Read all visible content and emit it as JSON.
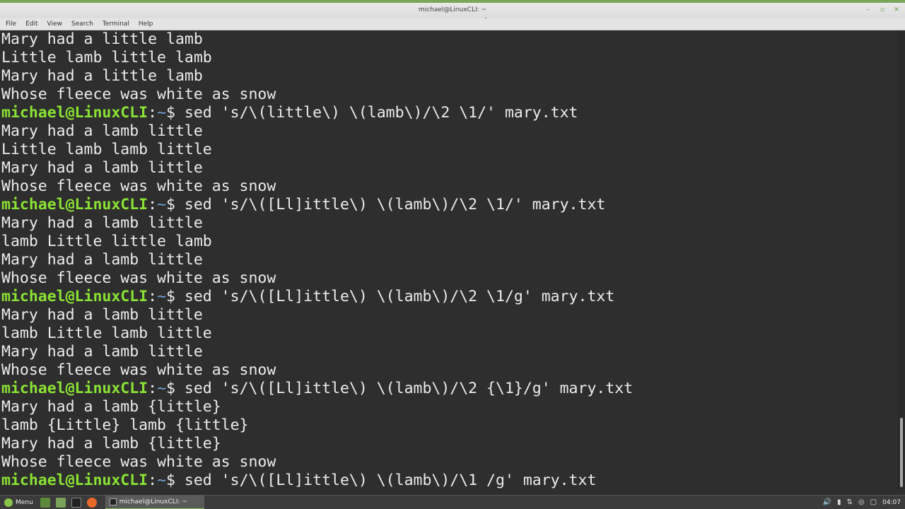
{
  "window": {
    "title": "michael@LinuxCLI: ~",
    "buttons": [
      "–",
      "▫",
      "✕"
    ]
  },
  "menubar": [
    "File",
    "Edit",
    "View",
    "Search",
    "Terminal",
    "Help"
  ],
  "prompt": {
    "user": "michael@LinuxCLI",
    "sep": ":",
    "path": "~",
    "sym": "$ "
  },
  "terminal_lines": [
    {
      "type": "out",
      "text": "Mary had a little lamb"
    },
    {
      "type": "out",
      "text": "Little lamb little lamb"
    },
    {
      "type": "out",
      "text": "Mary had a little lamb"
    },
    {
      "type": "out",
      "text": "Whose fleece was white as snow"
    },
    {
      "type": "cmd",
      "text": "sed 's/\\(little\\) \\(lamb\\)/\\2 \\1/' mary.txt"
    },
    {
      "type": "out",
      "text": "Mary had a lamb little"
    },
    {
      "type": "out",
      "text": "Little lamb lamb little"
    },
    {
      "type": "out",
      "text": "Mary had a lamb little"
    },
    {
      "type": "out",
      "text": "Whose fleece was white as snow"
    },
    {
      "type": "cmd",
      "text": "sed 's/\\([Ll]ittle\\) \\(lamb\\)/\\2 \\1/' mary.txt"
    },
    {
      "type": "out",
      "text": "Mary had a lamb little"
    },
    {
      "type": "out",
      "text": "lamb Little little lamb"
    },
    {
      "type": "out",
      "text": "Mary had a lamb little"
    },
    {
      "type": "out",
      "text": "Whose fleece was white as snow"
    },
    {
      "type": "cmd",
      "text": "sed 's/\\([Ll]ittle\\) \\(lamb\\)/\\2 \\1/g' mary.txt"
    },
    {
      "type": "out",
      "text": "Mary had a lamb little"
    },
    {
      "type": "out",
      "text": "lamb Little lamb little"
    },
    {
      "type": "out",
      "text": "Mary had a lamb little"
    },
    {
      "type": "out",
      "text": "Whose fleece was white as snow"
    },
    {
      "type": "cmd",
      "text": "sed 's/\\([Ll]ittle\\) \\(lamb\\)/\\2 {\\1}/g' mary.txt"
    },
    {
      "type": "out",
      "text": "Mary had a lamb {little}"
    },
    {
      "type": "out",
      "text": "lamb {Little} lamb {little}"
    },
    {
      "type": "out",
      "text": "Mary had a lamb {little}"
    },
    {
      "type": "out",
      "text": "Whose fleece was white as snow"
    },
    {
      "type": "cmd",
      "text": "sed 's/\\([Ll]ittle\\) \\(lamb\\)/\\1 /g' mary.txt"
    }
  ],
  "taskbar": {
    "menu_label": "Menu",
    "window_label": "michael@LinuxCLI: ~",
    "clock": "04:07",
    "tray_icons": [
      "volume-icon",
      "usb-icon",
      "network-icon",
      "shield-icon",
      "display-icon"
    ]
  },
  "colors": {
    "prompt_user": "#8ae234",
    "prompt_path": "#6fa3d6",
    "terminal_bg": "#2e2e2e",
    "terminal_fg": "#ececec"
  }
}
